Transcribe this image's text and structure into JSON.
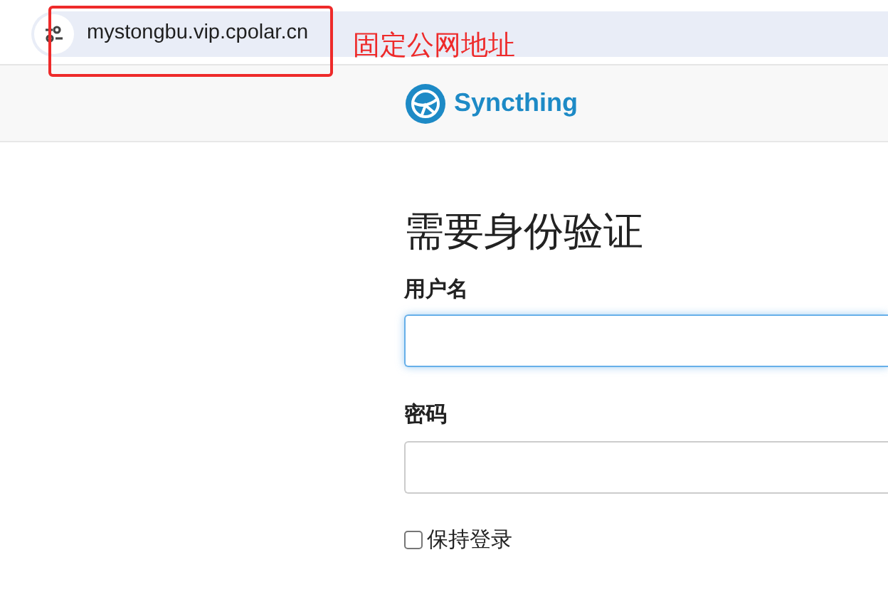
{
  "browser": {
    "address": "mystongbu.vip.cpolar.cn"
  },
  "annotation": {
    "label": "固定公网地址"
  },
  "navbar": {
    "brand": "Syncthing"
  },
  "form": {
    "heading": "需要身份验证",
    "fields": [
      {
        "label": "用户名",
        "focused": true
      },
      {
        "label": "密码",
        "focused": false
      }
    ],
    "remember": {
      "label": "保持登录",
      "checked": false
    }
  }
}
